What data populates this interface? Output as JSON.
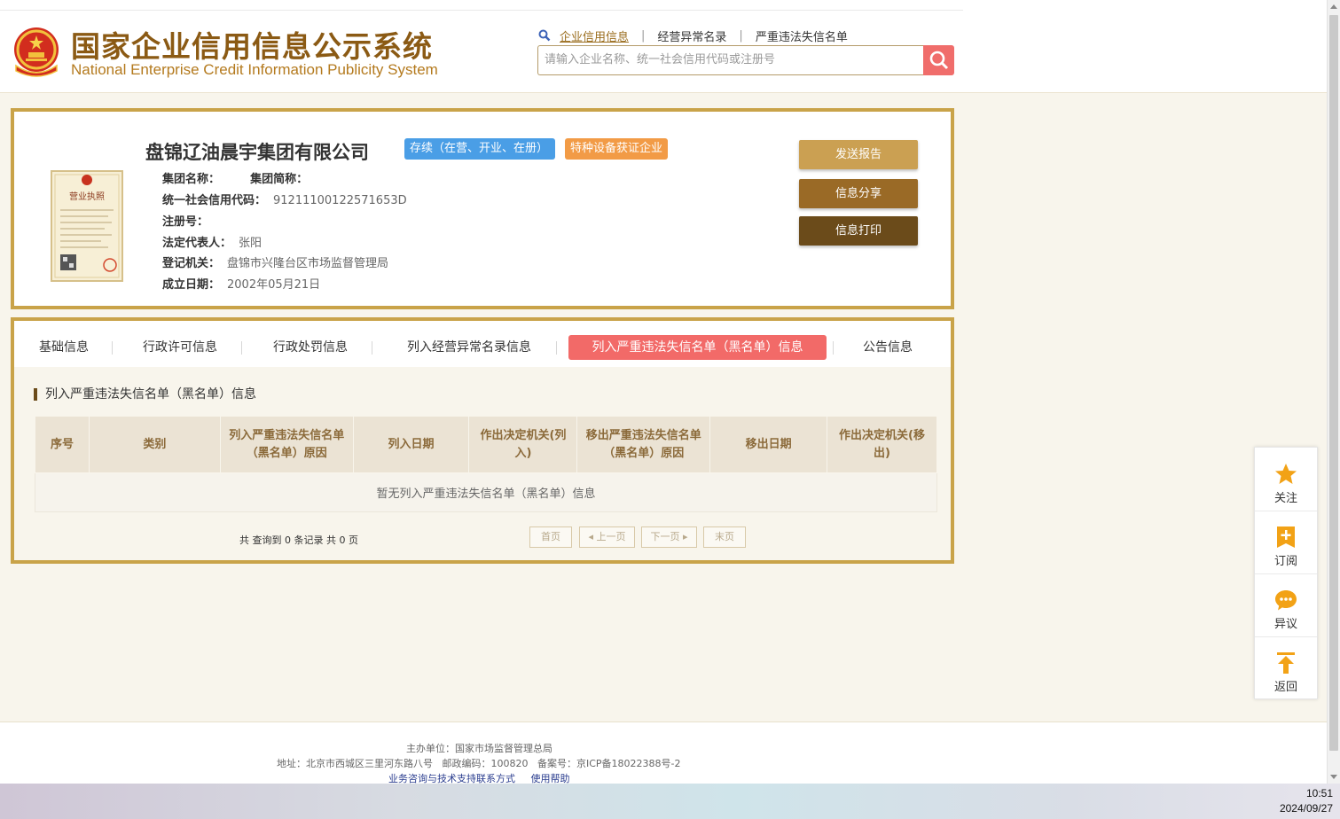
{
  "header": {
    "title_cn": "国家企业信用信息公示系统",
    "title_en": "National Enterprise Credit Information Publicity System",
    "search_links": [
      "企业信用信息",
      "经营异常名录",
      "严重违法失信名单"
    ],
    "search_placeholder": "请输入企业名称、统一社会信用代码或注册号"
  },
  "company": {
    "name": "盘锦辽油晨宇集团有限公司",
    "status_badge": "存续（在营、开业、在册）",
    "cert_badge": "特种设备获证企业",
    "group_name_label": "集团名称：",
    "group_short_label": "集团简称：",
    "credit_code_label": "统一社会信用代码：",
    "credit_code": "91211100122571653D",
    "reg_no_label": "注册号：",
    "legal_rep_label": "法定代表人：",
    "legal_rep": "张阳",
    "authority_label": "登记机关：",
    "authority": "盘锦市兴隆台区市场监督管理局",
    "founded_label": "成立日期：",
    "founded": "2002年05月21日",
    "license_text": "营业执照"
  },
  "actions": {
    "send_report": "发送报告",
    "share": "信息分享",
    "print": "信息打印"
  },
  "tabs": [
    "基础信息",
    "行政许可信息",
    "行政处罚信息",
    "列入经营异常名录信息",
    "列入严重违法失信名单（黑名单）信息",
    "公告信息"
  ],
  "section": {
    "title": "列入严重违法失信名单（黑名单）信息",
    "columns": [
      "序号",
      "类别",
      "列入严重违法失信名单（黑名单）原因",
      "列入日期",
      "作出决定机关(列入)",
      "移出严重违法失信名单（黑名单）原因",
      "移出日期",
      "作出决定机关(移出)"
    ],
    "empty_text": "暂无列入严重违法失信名单（黑名单）信息",
    "pager_summary": "共 查询到 0 条记录 共 0 页",
    "first": "首页",
    "prev": "上一页",
    "next": "下一页",
    "last": "末页"
  },
  "side": {
    "follow": "关注",
    "subscribe": "订阅",
    "objection": "异议",
    "back": "返回"
  },
  "footer": {
    "host": "主办单位：国家市场监督管理总局",
    "address": "地址：北京市西城区三里河东路八号",
    "postcode": "邮政编码：100820",
    "icp": "备案号：京ICP备18022388号-2",
    "support_link": "业务咨询与技术支持联系方式",
    "help_link": "使用帮助"
  },
  "taskbar": {
    "time": "10:51",
    "date": "2024/09/27"
  },
  "colors": {
    "gold_border": "#c9a349",
    "brand_brown": "#8b5a14",
    "active_tab": "#f26a68",
    "status_badge": "#4a9ee6",
    "cert_badge": "#f29b46"
  }
}
